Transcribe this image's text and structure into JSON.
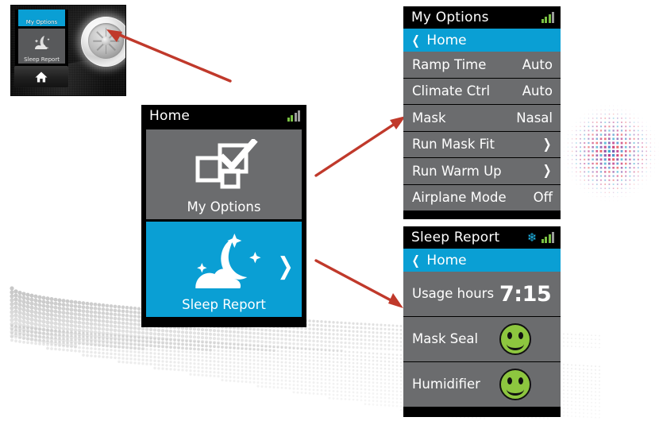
{
  "device_photo": {
    "name": "cpap-device-photo",
    "dial": "control-dial",
    "mini_screen": {
      "tile_options_label": "My Options",
      "tile_sleep_label": "Sleep Report"
    },
    "home_button": "home-button"
  },
  "colors": {
    "accent_blue": "#0a9fd4",
    "row_gray": "#6b6c6e",
    "screen_black": "#000000",
    "signal_green": "#7ac143",
    "smiley_green": "#8dc63f",
    "snowflake_blue": "#1fb6e8",
    "arrow_red": "#c0392b"
  },
  "screens": {
    "home": {
      "title": "Home",
      "status": {
        "signal_icon": "signal-bars",
        "signal_bars_lit": 2,
        "signal_bars_total": 4
      },
      "tiles": [
        {
          "label": "My Options",
          "icon": "checkbox-squares-icon",
          "style": "gray",
          "chevron": ""
        },
        {
          "label": "Sleep Report",
          "icon": "moon-cloud-stars-icon",
          "style": "blue",
          "chevron": "❯"
        }
      ]
    },
    "my_options": {
      "title": "My Options",
      "status": {
        "signal_icon": "signal-bars",
        "signal_bars_lit": 3,
        "signal_bars_total": 4
      },
      "back": {
        "label": "Home",
        "chevron": "❮"
      },
      "rows": [
        {
          "label": "Ramp Time",
          "value": "Auto",
          "type": "value"
        },
        {
          "label": "Climate Ctrl",
          "value": "Auto",
          "type": "value"
        },
        {
          "label": "Mask",
          "value": "Nasal",
          "type": "value"
        },
        {
          "label": "Run Mask Fit",
          "value": "❯",
          "type": "chevron"
        },
        {
          "label": "Run Warm Up",
          "value": "❯",
          "type": "chevron"
        },
        {
          "label": "Airplane Mode",
          "value": "Off",
          "type": "value"
        }
      ]
    },
    "sleep_report": {
      "title": "Sleep Report",
      "status": {
        "snowflake_icon": "snowflake-icon",
        "signal_icon": "signal-bars",
        "signal_bars_lit": 3,
        "signal_bars_total": 4
      },
      "back": {
        "label": "Home",
        "chevron": "❮"
      },
      "rows": [
        {
          "label": "Usage hours",
          "value": "7:15",
          "type": "value"
        },
        {
          "label": "Mask Seal",
          "value": "smiley-face-green",
          "type": "smiley"
        },
        {
          "label": "Humidifier",
          "value": "smiley-face-green",
          "type": "smiley"
        }
      ]
    }
  },
  "annotations": {
    "arrows": [
      {
        "name": "arrow-to-dial",
        "direction": "up-left"
      },
      {
        "name": "arrow-home-to-my-options",
        "direction": "up-right"
      },
      {
        "name": "arrow-home-to-sleep-report",
        "direction": "down-right"
      }
    ],
    "decor": [
      {
        "name": "halftone-dots-color"
      },
      {
        "name": "halftone-swoosh-gray"
      }
    ]
  }
}
